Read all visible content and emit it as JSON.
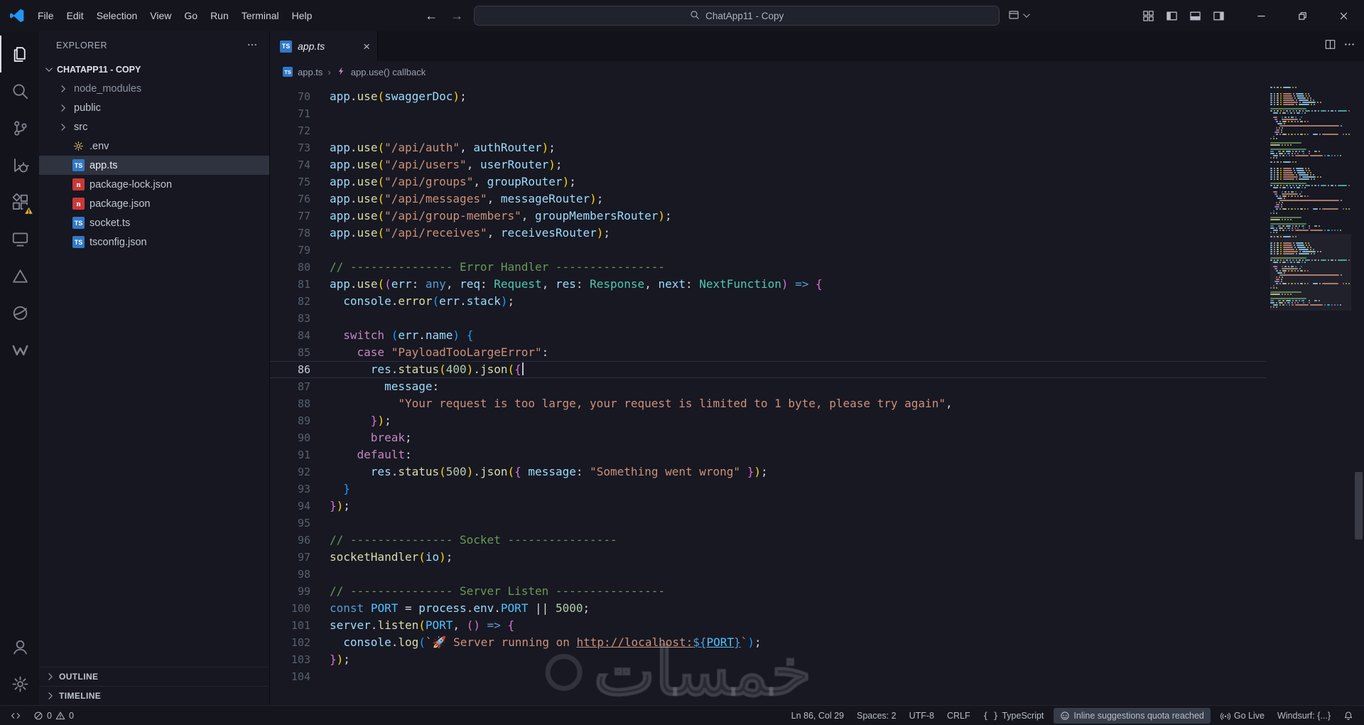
{
  "titlebar": {
    "menus": [
      "File",
      "Edit",
      "Selection",
      "View",
      "Go",
      "Run",
      "Terminal",
      "Help"
    ],
    "back_glyph": "←",
    "forward_glyph": "→",
    "search_text": "ChatApp11 - Copy",
    "layout_icons": [
      "layout-grid",
      "panel-left",
      "panel-bottom",
      "panel-right"
    ],
    "window_controls": [
      "minimize",
      "restore",
      "close"
    ]
  },
  "activitybar": {
    "top": [
      {
        "name": "explorer",
        "active": true
      },
      {
        "name": "search"
      },
      {
        "name": "source-control"
      },
      {
        "name": "run-and-debug"
      },
      {
        "name": "extensions",
        "badge": "warning"
      },
      {
        "name": "chat"
      },
      {
        "name": "triangle"
      },
      {
        "name": "globe"
      },
      {
        "name": "windsurf"
      }
    ],
    "bottom": [
      {
        "name": "accounts"
      },
      {
        "name": "settings"
      }
    ]
  },
  "sidebar": {
    "title": "EXPLORER",
    "section": "CHATAPP11 - COPY",
    "files": [
      {
        "label": "node_modules",
        "kind": "folder",
        "dim": true
      },
      {
        "label": "public",
        "kind": "folder"
      },
      {
        "label": "src",
        "kind": "folder"
      },
      {
        "label": ".env",
        "kind": "env"
      },
      {
        "label": "app.ts",
        "kind": "ts",
        "selected": true
      },
      {
        "label": "package-lock.json",
        "kind": "npm"
      },
      {
        "label": "package.json",
        "kind": "npm"
      },
      {
        "label": "socket.ts",
        "kind": "ts"
      },
      {
        "label": "tsconfig.json",
        "kind": "ts"
      }
    ],
    "bottom_sections": [
      "OUTLINE",
      "TIMELINE"
    ]
  },
  "editor": {
    "tab": {
      "label": "app.ts"
    },
    "breadcrumb": [
      {
        "icon": "ts",
        "label": "app.ts"
      },
      {
        "icon": "symbol-event",
        "label": "app.use() callback"
      }
    ],
    "cursor": {
      "line": 86,
      "col": 29
    },
    "total_lines": 104,
    "lines": [
      {
        "n": 70,
        "t": [
          [
            "app",
            "v"
          ],
          [
            ".",
            "w"
          ],
          [
            "use",
            "f"
          ],
          [
            "(",
            "b1"
          ],
          [
            "swaggerDoc",
            "v"
          ],
          [
            ")",
            "b1"
          ],
          [
            ";",
            "w"
          ]
        ]
      },
      {
        "n": 71,
        "t": []
      },
      {
        "n": 72,
        "t": []
      },
      {
        "n": 73,
        "t": [
          [
            "app",
            "v"
          ],
          [
            ".",
            "w"
          ],
          [
            "use",
            "f"
          ],
          [
            "(",
            "b1"
          ],
          [
            "\"/api/auth\"",
            "s"
          ],
          [
            ", ",
            "w"
          ],
          [
            "authRouter",
            "v"
          ],
          [
            ")",
            "b1"
          ],
          [
            ";",
            "w"
          ]
        ]
      },
      {
        "n": 74,
        "t": [
          [
            "app",
            "v"
          ],
          [
            ".",
            "w"
          ],
          [
            "use",
            "f"
          ],
          [
            "(",
            "b1"
          ],
          [
            "\"/api/users\"",
            "s"
          ],
          [
            ", ",
            "w"
          ],
          [
            "userRouter",
            "v"
          ],
          [
            ")",
            "b1"
          ],
          [
            ";",
            "w"
          ]
        ]
      },
      {
        "n": 75,
        "t": [
          [
            "app",
            "v"
          ],
          [
            ".",
            "w"
          ],
          [
            "use",
            "f"
          ],
          [
            "(",
            "b1"
          ],
          [
            "\"/api/groups\"",
            "s"
          ],
          [
            ", ",
            "w"
          ],
          [
            "groupRouter",
            "v"
          ],
          [
            ")",
            "b1"
          ],
          [
            ";",
            "w"
          ]
        ]
      },
      {
        "n": 76,
        "t": [
          [
            "app",
            "v"
          ],
          [
            ".",
            "w"
          ],
          [
            "use",
            "f"
          ],
          [
            "(",
            "b1"
          ],
          [
            "\"/api/messages\"",
            "s"
          ],
          [
            ", ",
            "w"
          ],
          [
            "messageRouter",
            "v"
          ],
          [
            ")",
            "b1"
          ],
          [
            ";",
            "w"
          ]
        ]
      },
      {
        "n": 77,
        "t": [
          [
            "app",
            "v"
          ],
          [
            ".",
            "w"
          ],
          [
            "use",
            "f"
          ],
          [
            "(",
            "b1"
          ],
          [
            "\"/api/group-members\"",
            "s"
          ],
          [
            ", ",
            "w"
          ],
          [
            "groupMembersRouter",
            "v"
          ],
          [
            ")",
            "b1"
          ],
          [
            ";",
            "w"
          ]
        ]
      },
      {
        "n": 78,
        "t": [
          [
            "app",
            "v"
          ],
          [
            ".",
            "w"
          ],
          [
            "use",
            "f"
          ],
          [
            "(",
            "b1"
          ],
          [
            "\"/api/receives\"",
            "s"
          ],
          [
            ", ",
            "w"
          ],
          [
            "receivesRouter",
            "v"
          ],
          [
            ")",
            "b1"
          ],
          [
            ";",
            "w"
          ]
        ]
      },
      {
        "n": 79,
        "t": []
      },
      {
        "n": 80,
        "t": [
          [
            "// --------------- Error Handler ----------------",
            "c"
          ]
        ]
      },
      {
        "n": 81,
        "t": [
          [
            "app",
            "v"
          ],
          [
            ".",
            "w"
          ],
          [
            "use",
            "f"
          ],
          [
            "(",
            "b1"
          ],
          [
            "(",
            "b2"
          ],
          [
            "err",
            "v"
          ],
          [
            ": ",
            "w"
          ],
          [
            "any",
            "kb"
          ],
          [
            ", ",
            "w"
          ],
          [
            "req",
            "v"
          ],
          [
            ": ",
            "w"
          ],
          [
            "Request",
            "t"
          ],
          [
            ", ",
            "w"
          ],
          [
            "res",
            "v"
          ],
          [
            ": ",
            "w"
          ],
          [
            "Response",
            "t"
          ],
          [
            ", ",
            "w"
          ],
          [
            "next",
            "v"
          ],
          [
            ": ",
            "w"
          ],
          [
            "NextFunction",
            "t"
          ],
          [
            ")",
            "b2"
          ],
          [
            " ",
            "w"
          ],
          [
            "=>",
            "kb"
          ],
          [
            " ",
            "w"
          ],
          [
            "{",
            "b2"
          ]
        ]
      },
      {
        "n": 82,
        "t": [
          [
            "  ",
            "w"
          ],
          [
            "console",
            "v"
          ],
          [
            ".",
            "w"
          ],
          [
            "error",
            "f"
          ],
          [
            "(",
            "b3"
          ],
          [
            "err",
            "v"
          ],
          [
            ".",
            "w"
          ],
          [
            "stack",
            "v"
          ],
          [
            ")",
            "b3"
          ],
          [
            ";",
            "w"
          ]
        ]
      },
      {
        "n": 83,
        "t": []
      },
      {
        "n": 84,
        "t": [
          [
            "  ",
            "w"
          ],
          [
            "switch",
            "k"
          ],
          [
            " ",
            "w"
          ],
          [
            "(",
            "b3"
          ],
          [
            "err",
            "v"
          ],
          [
            ".",
            "w"
          ],
          [
            "name",
            "v"
          ],
          [
            ")",
            "b3"
          ],
          [
            " ",
            "w"
          ],
          [
            "{",
            "b3"
          ]
        ]
      },
      {
        "n": 85,
        "t": [
          [
            "    ",
            "w"
          ],
          [
            "case",
            "k"
          ],
          [
            " ",
            "w"
          ],
          [
            "\"PayloadTooLargeError\"",
            "s"
          ],
          [
            ":",
            "w"
          ]
        ]
      },
      {
        "n": 86,
        "t": [
          [
            "      ",
            "w"
          ],
          [
            "res",
            "v"
          ],
          [
            ".",
            "w"
          ],
          [
            "status",
            "f"
          ],
          [
            "(",
            "b1"
          ],
          [
            "400",
            "n"
          ],
          [
            ")",
            "b1"
          ],
          [
            ".",
            "w"
          ],
          [
            "json",
            "f"
          ],
          [
            "(",
            "b1"
          ],
          [
            "{",
            "b2"
          ]
        ]
      },
      {
        "n": 87,
        "t": [
          [
            "        ",
            "w"
          ],
          [
            "message",
            "v"
          ],
          [
            ":",
            "w"
          ]
        ]
      },
      {
        "n": 88,
        "t": [
          [
            "          ",
            "w"
          ],
          [
            "\"Your request is too large, your request is limited to 1 byte, please try again\"",
            "s"
          ],
          [
            ",",
            "w"
          ]
        ]
      },
      {
        "n": 89,
        "t": [
          [
            "      ",
            "w"
          ],
          [
            "}",
            "b2"
          ],
          [
            ")",
            "b1"
          ],
          [
            ";",
            "w"
          ]
        ]
      },
      {
        "n": 90,
        "t": [
          [
            "      ",
            "w"
          ],
          [
            "break",
            "k"
          ],
          [
            ";",
            "w"
          ]
        ]
      },
      {
        "n": 91,
        "t": [
          [
            "    ",
            "w"
          ],
          [
            "default",
            "k"
          ],
          [
            ":",
            "w"
          ]
        ]
      },
      {
        "n": 92,
        "t": [
          [
            "      ",
            "w"
          ],
          [
            "res",
            "v"
          ],
          [
            ".",
            "w"
          ],
          [
            "status",
            "f"
          ],
          [
            "(",
            "b1"
          ],
          [
            "500",
            "n"
          ],
          [
            ")",
            "b1"
          ],
          [
            ".",
            "w"
          ],
          [
            "json",
            "f"
          ],
          [
            "(",
            "b1"
          ],
          [
            "{",
            "b2"
          ],
          [
            " ",
            "w"
          ],
          [
            "message",
            "v"
          ],
          [
            ": ",
            "w"
          ],
          [
            "\"Something went wrong\"",
            "s"
          ],
          [
            " ",
            "w"
          ],
          [
            "}",
            "b2"
          ],
          [
            ")",
            "b1"
          ],
          [
            ";",
            "w"
          ]
        ]
      },
      {
        "n": 93,
        "t": [
          [
            "  ",
            "w"
          ],
          [
            "}",
            "b3"
          ]
        ]
      },
      {
        "n": 94,
        "t": [
          [
            "}",
            "b2"
          ],
          [
            ")",
            "b1"
          ],
          [
            ";",
            "w"
          ]
        ]
      },
      {
        "n": 95,
        "t": []
      },
      {
        "n": 96,
        "t": [
          [
            "// --------------- Socket ----------------",
            "c"
          ]
        ]
      },
      {
        "n": 97,
        "t": [
          [
            "socketHandler",
            "f"
          ],
          [
            "(",
            "b1"
          ],
          [
            "io",
            "v"
          ],
          [
            ")",
            "b1"
          ],
          [
            ";",
            "w"
          ]
        ]
      },
      {
        "n": 98,
        "t": []
      },
      {
        "n": 99,
        "t": [
          [
            "// --------------- Server Listen ----------------",
            "c"
          ]
        ]
      },
      {
        "n": 100,
        "t": [
          [
            "const",
            "kb"
          ],
          [
            " ",
            "w"
          ],
          [
            "PORT",
            "vc"
          ],
          [
            " = ",
            "w"
          ],
          [
            "process",
            "v"
          ],
          [
            ".",
            "w"
          ],
          [
            "env",
            "v"
          ],
          [
            ".",
            "w"
          ],
          [
            "PORT",
            "vc"
          ],
          [
            " ",
            "w"
          ],
          [
            "||",
            "w"
          ],
          [
            " ",
            "w"
          ],
          [
            "5000",
            "n"
          ],
          [
            ";",
            "w"
          ]
        ]
      },
      {
        "n": 101,
        "t": [
          [
            "server",
            "v"
          ],
          [
            ".",
            "w"
          ],
          [
            "listen",
            "f"
          ],
          [
            "(",
            "b1"
          ],
          [
            "PORT",
            "vc"
          ],
          [
            ", ",
            "w"
          ],
          [
            "(",
            "b2"
          ],
          [
            ")",
            "b2"
          ],
          [
            " ",
            "w"
          ],
          [
            "=>",
            "kb"
          ],
          [
            " ",
            "w"
          ],
          [
            "{",
            "b2"
          ]
        ]
      },
      {
        "n": 102,
        "t": [
          [
            "  ",
            "w"
          ],
          [
            "console",
            "v"
          ],
          [
            ".",
            "w"
          ],
          [
            "log",
            "f"
          ],
          [
            "(",
            "b3"
          ],
          [
            "`",
            "s"
          ],
          [
            "🚀 ",
            "s"
          ],
          [
            "Server running on ",
            "s"
          ],
          [
            "http://localhost:",
            "u"
          ],
          [
            "${",
            "kbu"
          ],
          [
            "PORT",
            "vcu"
          ],
          [
            "}",
            "kbu"
          ],
          [
            "`",
            "s"
          ],
          [
            ")",
            "b3"
          ],
          [
            ";",
            "w"
          ]
        ]
      },
      {
        "n": 103,
        "t": [
          [
            "}",
            "b2"
          ],
          [
            ")",
            "b1"
          ],
          [
            ";",
            "w"
          ]
        ]
      },
      {
        "n": 104,
        "t": []
      }
    ]
  },
  "colors": {
    "v": "#9CDCFE",
    "vc": "#4FC1FF",
    "f": "#DCDCAA",
    "s": "#CE9178",
    "k": "#C586C0",
    "kb": "#569CD6",
    "t": "#4EC9B0",
    "n": "#B5CEA8",
    "c": "#6A9955",
    "w": "#D4D4D4",
    "b1": "#FFD700",
    "b2": "#DA70D6",
    "b3": "#179FFF"
  },
  "statusbar": {
    "problems": {
      "errors": "0",
      "warnings": "0"
    },
    "right": [
      {
        "id": "cursor-position",
        "label": "Ln 86, Col 29"
      },
      {
        "id": "indentation",
        "label": "Spaces: 2"
      },
      {
        "id": "encoding",
        "label": "UTF-8"
      },
      {
        "id": "eol",
        "label": "CRLF"
      },
      {
        "id": "language-mode",
        "label": "TypeScript",
        "icon": "braces"
      },
      {
        "id": "copilot-quota",
        "label": "Inline suggestions quota reached",
        "icon": "copilot",
        "chip": true
      },
      {
        "id": "go-live",
        "label": "Go Live",
        "icon": "broadcast"
      },
      {
        "id": "windsurf",
        "label": "Windsurf: {...}"
      },
      {
        "id": "notifications",
        "label": "",
        "icon": "bell"
      }
    ]
  },
  "watermark": {
    "text": "خمسات"
  }
}
